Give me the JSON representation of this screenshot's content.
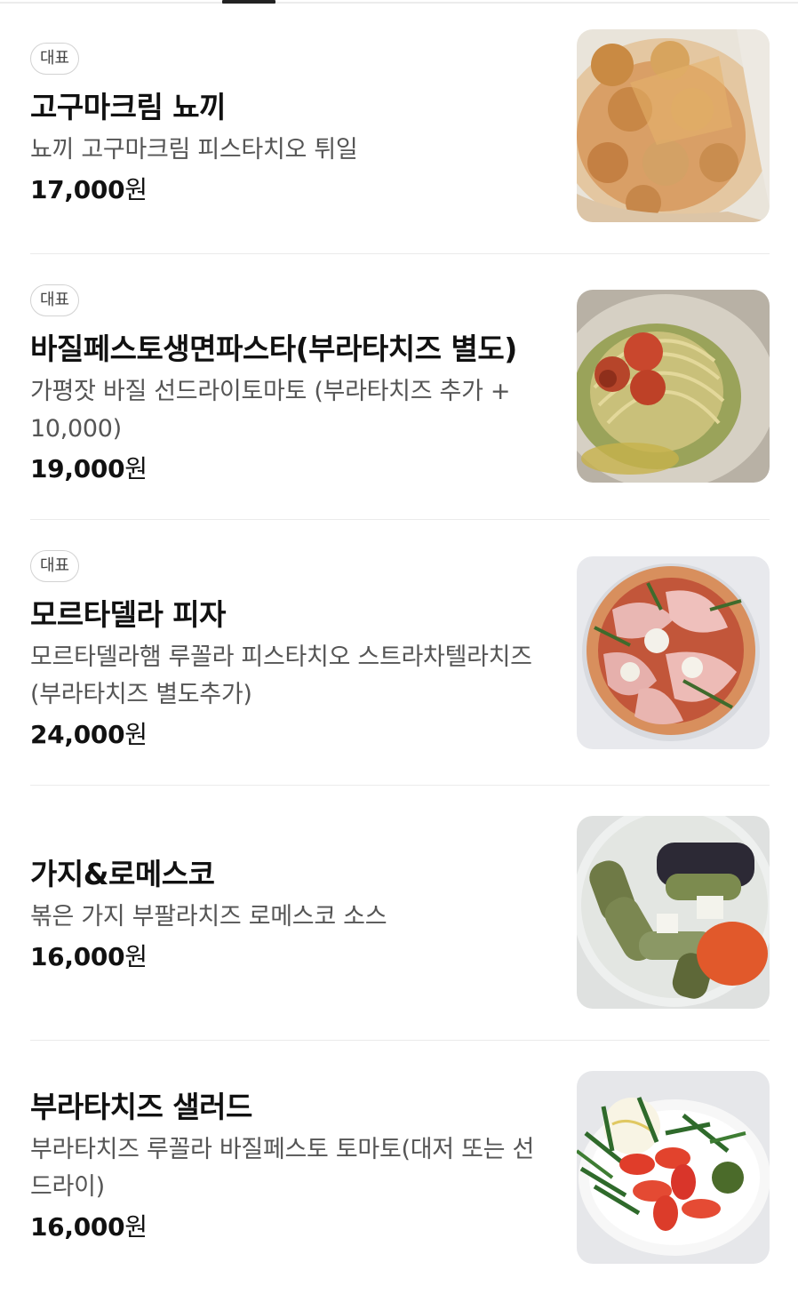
{
  "badge_label": "대표",
  "currency": "원",
  "items": [
    {
      "name": "고구마크림 뇨끼",
      "description": "뇨끼 고구마크림 피스타치오 튀일",
      "price": "17,000",
      "featured": true,
      "image_icon": "gnocchi-photo"
    },
    {
      "name": "바질페스토생면파스타(부라타치즈 별도)",
      "description": "가평잣 바질 선드라이토마토 (부라타치즈 추가 + 10,000)",
      "price": "19,000",
      "featured": true,
      "image_icon": "pesto-pasta-photo"
    },
    {
      "name": "모르타델라 피자",
      "description": "모르타델라햄 루꼴라 피스타치오 스트라차텔라치즈 (부라타치즈 별도추가)",
      "price": "24,000",
      "featured": true,
      "image_icon": "mortadella-pizza-photo"
    },
    {
      "name": "가지&로메스코",
      "description": "볶은 가지 부팔라치즈 로메스코 소스",
      "price": "16,000",
      "featured": false,
      "image_icon": "eggplant-romesco-photo"
    },
    {
      "name": "부라타치즈 샐러드",
      "description": "부라타치즈 루꼴라 바질페스토 토마토(대저 또는 선드라이)",
      "price": "16,000",
      "featured": false,
      "image_icon": "burrata-salad-photo"
    }
  ]
}
